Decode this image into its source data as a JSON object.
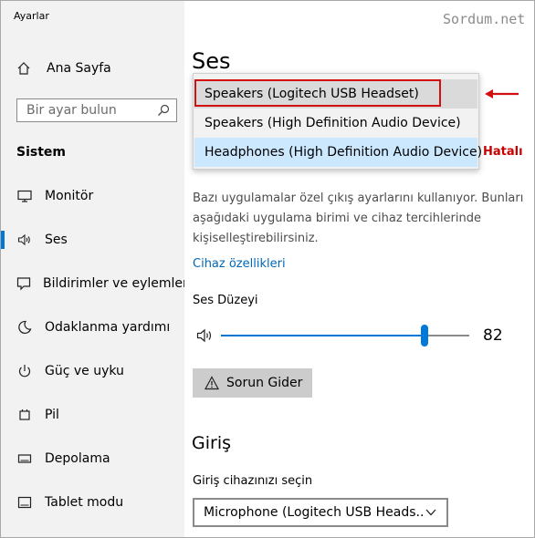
{
  "app": {
    "title": "Ayarlar"
  },
  "sidebar": {
    "home_label": "Ana Sayfa",
    "search_placeholder": "Bir ayar bulun",
    "section_title": "Sistem",
    "items": [
      {
        "label": "Monitör",
        "icon": "monitor-icon"
      },
      {
        "label": "Ses",
        "icon": "speaker-icon",
        "active": true
      },
      {
        "label": "Bildirimler ve eylemler",
        "icon": "notification-icon"
      },
      {
        "label": "Odaklanma yardımı",
        "icon": "moon-icon"
      },
      {
        "label": "Güç ve uyku",
        "icon": "power-icon"
      },
      {
        "label": "Pil",
        "icon": "battery-icon"
      },
      {
        "label": "Depolama",
        "icon": "storage-icon"
      },
      {
        "label": "Tablet modu",
        "icon": "tablet-icon"
      }
    ]
  },
  "main": {
    "heading": "Ses",
    "output_dropdown": {
      "options": [
        "Speakers (Logitech USB Headset)",
        "Speakers (High Definition Audio Device)",
        "Headphones (High Definition Audio Device)"
      ],
      "selected": "Headphones (High Definition Audio Device)"
    },
    "description": "Bazı uygulamalar özel çıkış ayarlarını kullanıyor. Bunları aşağıdaki uygulama birimi ve cihaz tercihlerinde kişiselleştirebilirsiniz.",
    "device_properties_link": "Cihaz özellikleri",
    "volume_label": "Ses Düzeyi",
    "volume_value": "82",
    "volume_level": 0.82,
    "troubleshoot_label": "Sorun Gider",
    "input_heading": "Giriş",
    "input_device_label": "Giriş cihazınızı seçin",
    "input_device_value": "Microphone (Logitech USB Heads..."
  },
  "annotations": {
    "watermark": "Sordum.net",
    "error_label": "Hatalı"
  },
  "colors": {
    "accent": "#0078d7",
    "link": "#0067b8",
    "sidebar_bg": "#f2f2f2",
    "selected_option_bg": "#cce8ff",
    "annotation_red": "#d21010"
  }
}
